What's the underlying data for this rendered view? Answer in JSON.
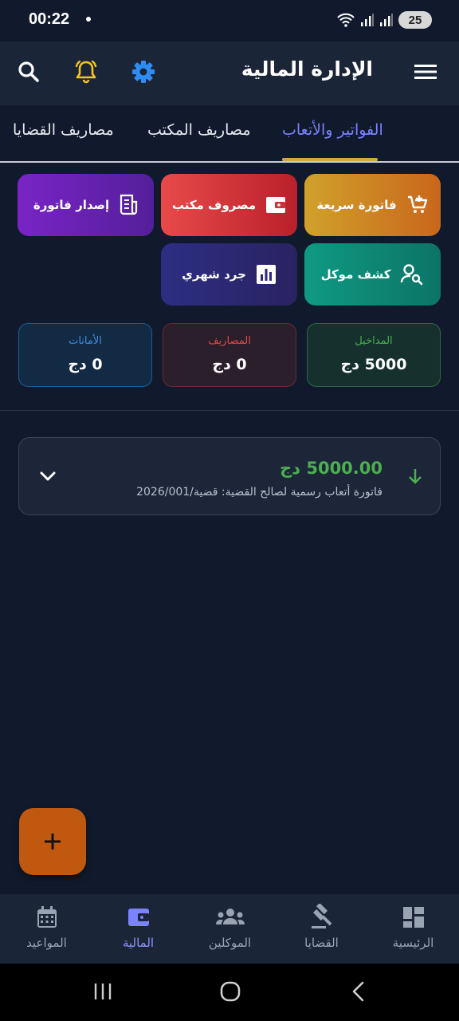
{
  "status_bar": {
    "time": "00:22",
    "battery": "25"
  },
  "app_bar": {
    "title": "الإدارة المالية"
  },
  "tabs": [
    {
      "label": "الفواتير والأتعاب",
      "active": true
    },
    {
      "label": "مصاريف المكتب",
      "active": false
    },
    {
      "label": "مصاريف القضايا",
      "active": false
    }
  ],
  "actions": {
    "quick_invoice": "فاتورة سريعة",
    "office_expense": "مصروف مكتب",
    "issue_invoice": "إصدار فاتورة",
    "client_statement": "كشف موكل",
    "monthly_inventory": "جرد شهري"
  },
  "stats": {
    "income": {
      "label": "المداخيل",
      "value": "5000 دج",
      "color": "#4caf50"
    },
    "expenses": {
      "label": "المصاريف",
      "value": "0 دج",
      "color": "#e04b4b"
    },
    "deposits": {
      "label": "الأمانات",
      "value": "0 دج",
      "color": "#3d8fe0"
    }
  },
  "transactions": [
    {
      "amount": "5000.00 دج",
      "description": "فاتورة أتعاب رسمية لصالح القضية: قضية/2026/001"
    }
  ],
  "bottom_nav": [
    {
      "label": "الرئيسية",
      "icon": "dashboard-icon",
      "active": false
    },
    {
      "label": "القضايا",
      "icon": "gavel-icon",
      "active": false
    },
    {
      "label": "الموكلين",
      "icon": "groups-icon",
      "active": false
    },
    {
      "label": "المالية",
      "icon": "wallet-icon",
      "active": true
    },
    {
      "label": "المواعيد",
      "icon": "calendar-icon",
      "active": false
    }
  ],
  "colors": {
    "background": "#111a2d",
    "app_bar": "#1b2538",
    "accent": "#7b83ff",
    "tab_indicator": "#d2a93c",
    "fab": "#c0580f"
  }
}
